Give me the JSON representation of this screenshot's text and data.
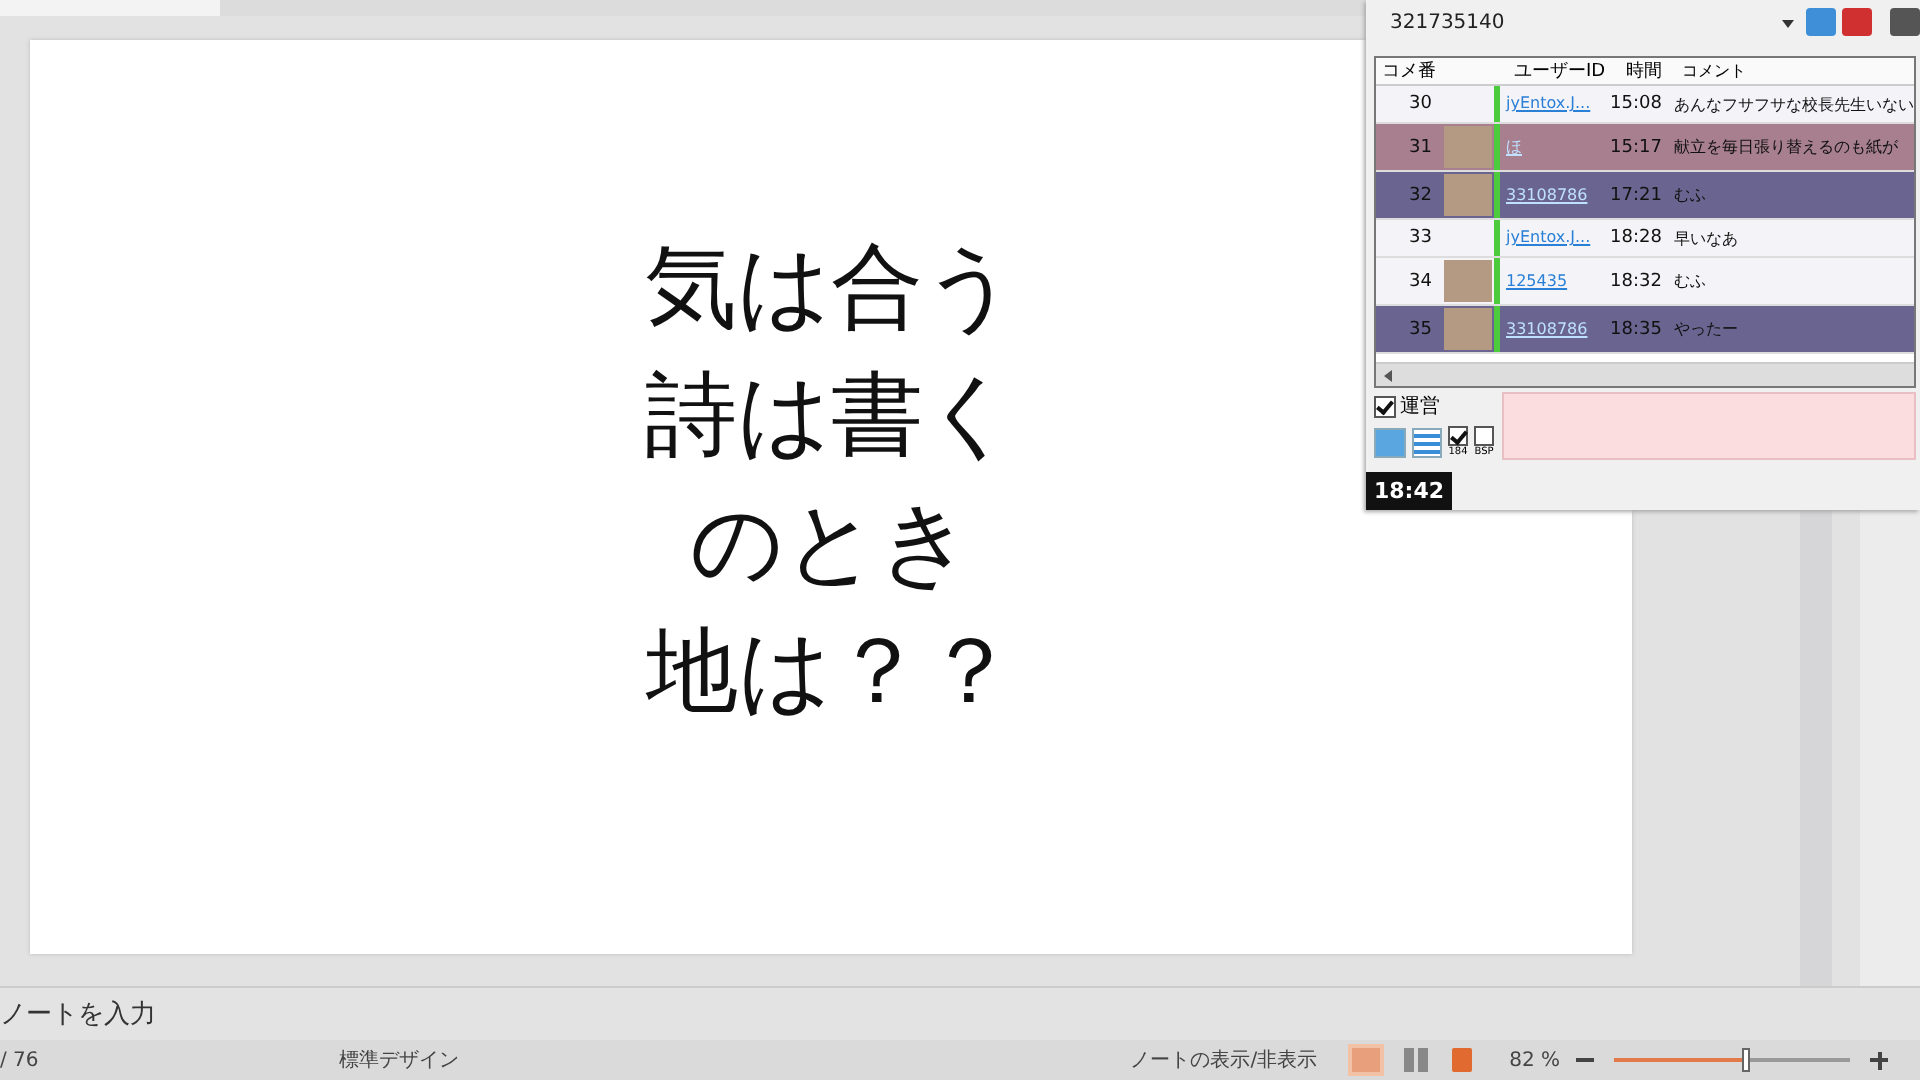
{
  "slide": {
    "lines": [
      "気は合う",
      "詩は書く",
      "のとき",
      "地は？？"
    ]
  },
  "notes": {
    "placeholder": "ノートを入力"
  },
  "status_bar": {
    "slide_count": "/ 76",
    "theme": "標準デザイン",
    "notes_toggle": "ノートの表示/非表示",
    "zoom": "82 %",
    "zoom_slider": {
      "level": 0.56
    }
  },
  "comment_panel": {
    "live_id": "321735140",
    "columns": [
      "コメ番",
      "ユーザーID",
      "時間",
      "コメント"
    ],
    "rows": [
      {
        "number": "30",
        "avatar": false,
        "user": "jyEntox.J...",
        "time": "15:08",
        "comment": "あんなフサフサな校長先生いない",
        "color": "#f4f4f8"
      },
      {
        "number": "31",
        "avatar": true,
        "user": "ほ",
        "time": "15:17",
        "comment": "献立を毎日張り替えるのも紙が",
        "color": "#a77f8e"
      },
      {
        "number": "32",
        "avatar": true,
        "user": "33108786",
        "time": "17:21",
        "comment": "むふ",
        "color": "#6a6490"
      },
      {
        "number": "33",
        "avatar": false,
        "user": "jyEntox.J...",
        "time": "18:28",
        "comment": "早いなあ",
        "color": "#f4f4f8"
      },
      {
        "number": "34",
        "avatar": true,
        "user": "125435",
        "time": "18:32",
        "comment": "むふ",
        "color": "#f4f4f8"
      },
      {
        "number": "35",
        "avatar": true,
        "user": "33108786",
        "time": "18:35",
        "comment": "やったー",
        "color": "#6a6490"
      }
    ],
    "operator_check": {
      "label": "運営",
      "checked": true
    },
    "id_check": {
      "label": "184",
      "checked": true
    },
    "bsp_check": {
      "label": "BSP",
      "checked": false
    },
    "clock": "18:42"
  }
}
